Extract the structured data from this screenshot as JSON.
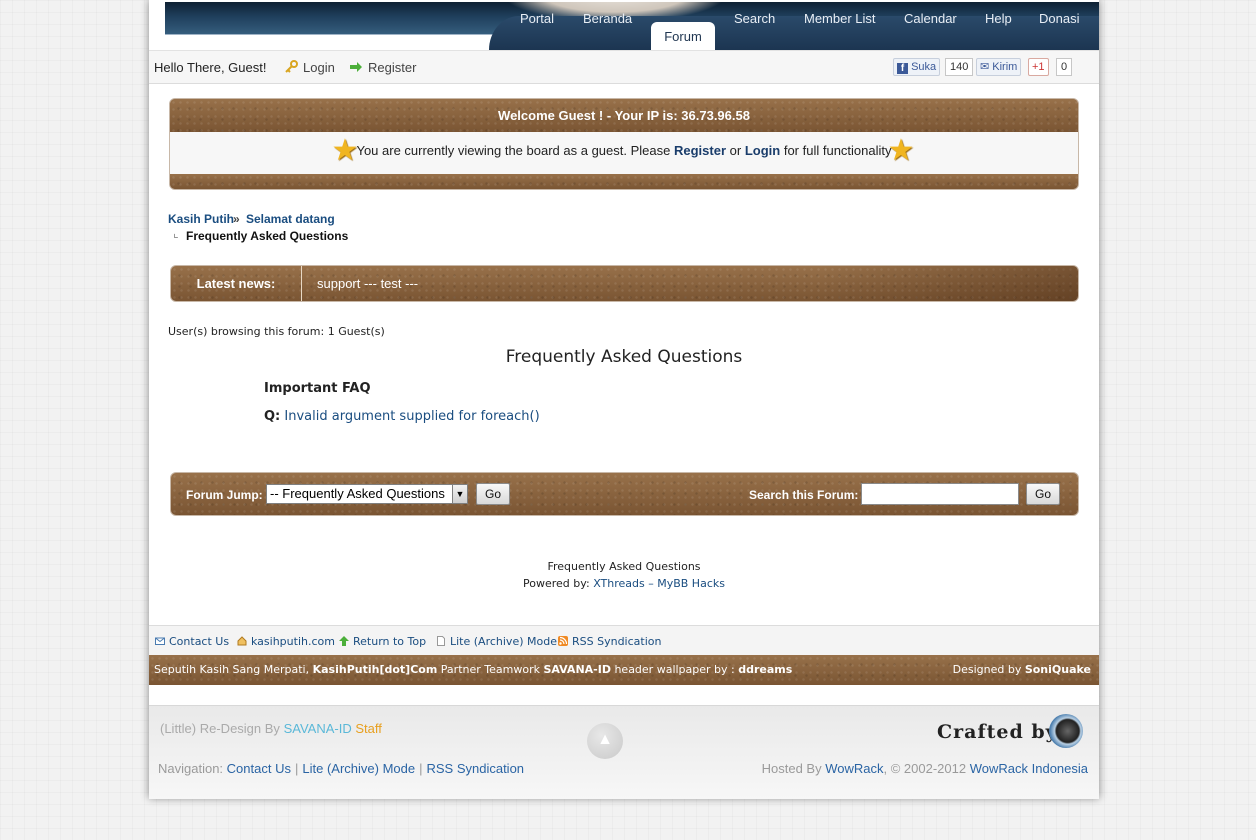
{
  "nav": {
    "items": [
      "Portal",
      "Beranda",
      "Forum",
      "Search",
      "Member List",
      "Calendar",
      "Help",
      "Donasi"
    ],
    "active": "Forum"
  },
  "welcome": {
    "greeting": "Hello There, Guest!",
    "login": "Login",
    "register": "Register",
    "like_label": "Suka",
    "like_count": "140",
    "send_label": "Kirim",
    "gplus_label": "+1",
    "gplus_count": "0"
  },
  "guest_box": {
    "header": "Welcome Guest ! - Your IP is: 36.73.96.58",
    "message_pre": "You are currently viewing the board as a guest. Please",
    "register": "Register",
    "or": "or",
    "login": "Login",
    "message_post": "for full functionality"
  },
  "breadcrumb": {
    "root": "Kasih Putih",
    "parent": "Selamat datang",
    "current": "Frequently Asked Questions"
  },
  "news": {
    "label": "Latest news:",
    "text": "support --- test ---"
  },
  "browsing": "User(s) browsing this forum: 1 Guest(s)",
  "page_title": "Frequently Asked Questions",
  "faq": {
    "section": "Important FAQ",
    "q_label": "Q:",
    "question": "Invalid argument supplied for foreach()"
  },
  "forum_jump": {
    "label": "Forum Jump:",
    "selected": "-- Frequently Asked Questions",
    "go": "Go",
    "search_label": "Search this Forum:",
    "search_value": "",
    "search_go": "Go"
  },
  "footer_info": {
    "title": "Frequently Asked Questions",
    "powered_prefix": "Powered by:",
    "powered_link": "XThreads – MyBB Hacks"
  },
  "link_bar": [
    "Contact Us",
    "kasihputih.com",
    "Return to Top",
    "Lite (Archive) Mode",
    "RSS Syndication"
  ],
  "copyright": {
    "part1": "Seputih Kasih Sang Merpati,",
    "brand": "KasihPutih[dot]Com",
    "part2": "Partner Teamwork",
    "partner": "SAVANA-ID",
    "part3": "header wallpaper by :",
    "wallpaper_by": "ddreams",
    "designed_prefix": "Designed by",
    "designer": "SoniQuake"
  },
  "outer_footer": {
    "redesign_prefix": "(Little) Re-Design By",
    "redesign_team": "SAVANA-ID",
    "redesign_staff": "Staff",
    "crafted": "Crafted by",
    "nav_prefix": "Navigation:",
    "nav_links": [
      "Contact Us",
      "Lite (Archive) Mode",
      "RSS Syndication"
    ],
    "hosted_prefix": "Hosted By",
    "host": "WowRack",
    "copyright": ", © 2002-2012",
    "host_full": "WowRack Indonesia"
  },
  "colors": {
    "brown_bar": "#8a6440",
    "nav_blue": "#1c3551",
    "link_blue": "#1a4d80",
    "savana_blue": "#5ab8d8",
    "staff_orange": "#e8a020"
  }
}
